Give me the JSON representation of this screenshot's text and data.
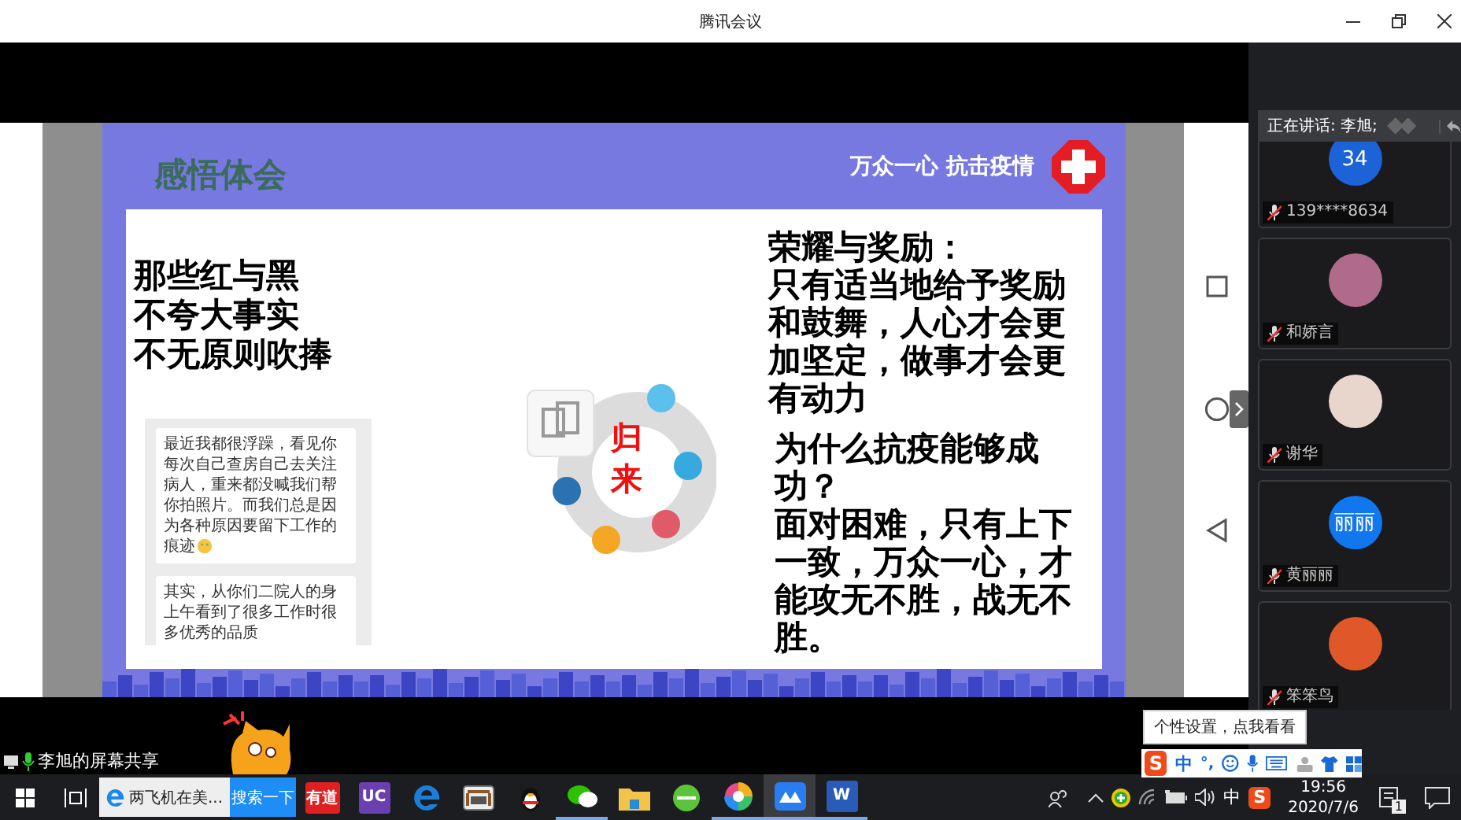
{
  "window": {
    "title": "腾讯会议"
  },
  "slide": {
    "title": "感悟体会",
    "slogan": "万众一心 抗击疫情",
    "left_lines": [
      "那些红与黑",
      "不夸大事实",
      "不无原则吹捧"
    ],
    "chat_bubbles": [
      {
        "text": "最近我都很浮躁，看见你每次自己查房自己去关注病人，重来都没喊我们帮你拍照片。而我们总是因为各种原因要留下工作的痕迹",
        "emoji": true
      },
      {
        "text": "其实，从你们二院人的身上午看到了很多工作时很多优秀的品质",
        "emoji": false
      }
    ],
    "diagram_label": "归来",
    "right_sections": [
      {
        "heading": "荣耀与奖励：",
        "body": "只有适当地给予奖励和鼓舞，人心才会更加坚定，做事才会更有动力"
      },
      {
        "heading": "为什么抗疫能够成功？",
        "body": "面对困难，只有上下一致，万众一心，才能攻无不胜，战无不胜。"
      }
    ]
  },
  "share_label": "李旭的屏幕共享",
  "side_panel": {
    "speaking": "正在讲话: 李旭;",
    "participants": [
      {
        "name": "139****8634",
        "muted": true,
        "avatar": {
          "kind": "text",
          "text": "34",
          "color": "#1b63d6"
        }
      },
      {
        "name": "和娇言",
        "muted": true,
        "avatar": {
          "kind": "photo",
          "color": "#b06a8a"
        }
      },
      {
        "name": "谢华",
        "muted": true,
        "avatar": {
          "kind": "photo",
          "color": "#e8d6cc"
        }
      },
      {
        "name": "黄丽丽",
        "muted": true,
        "avatar": {
          "kind": "text",
          "text": "丽丽",
          "color": "#1177ee"
        }
      },
      {
        "name": "笨笨鸟",
        "muted": true,
        "avatar": {
          "kind": "photo",
          "color": "#e0582a"
        }
      }
    ]
  },
  "tooltip": "个性设置，点我看看",
  "ime_bar": {
    "logo": "S",
    "mode": "中",
    "punctuation": "°,"
  },
  "taskbar": {
    "search_text": "两飞机在美...",
    "search_button": "搜索一下",
    "apps": [
      {
        "kind": "youdao",
        "label": "有道",
        "selected": false,
        "running": false
      },
      {
        "kind": "uc",
        "label": "UC",
        "selected": false,
        "running": false
      },
      {
        "kind": "edge",
        "selected": false,
        "running": false
      },
      {
        "kind": "media",
        "selected": false,
        "running": false
      },
      {
        "kind": "qq",
        "selected": false,
        "running": false
      },
      {
        "kind": "wechat",
        "selected": false,
        "running": true
      },
      {
        "kind": "folder",
        "selected": false,
        "running": false
      },
      {
        "kind": "green",
        "selected": false,
        "running": false
      },
      {
        "kind": "pinwheel",
        "selected": false,
        "running": true
      },
      {
        "kind": "meeting",
        "selected": true,
        "running": true
      },
      {
        "kind": "word",
        "label": "W",
        "selected": false,
        "running": true
      }
    ],
    "tray_ime": "中",
    "tray_logo": "S",
    "time": "19:56",
    "date": "2020/7/6",
    "notification_count": "1"
  }
}
